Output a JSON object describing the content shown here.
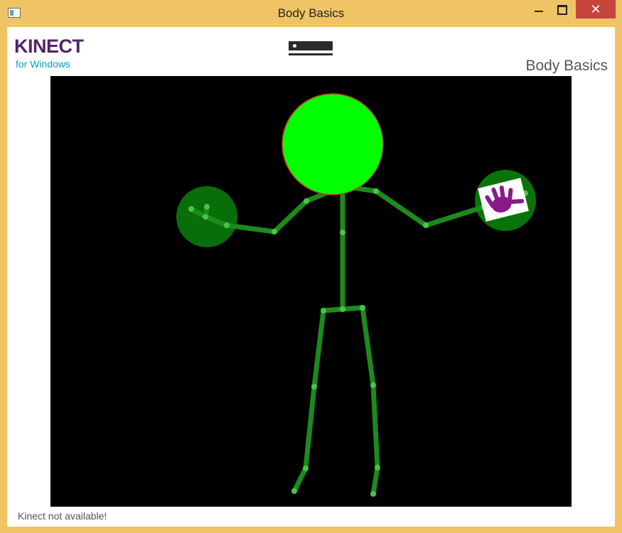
{
  "window": {
    "title": "Body Basics",
    "minimize_label": "",
    "maximize_label": "",
    "close_label": "✕"
  },
  "header": {
    "logo_main": "KINECT",
    "logo_sub": "for Windows",
    "app_title": "Body Basics"
  },
  "status": {
    "text": "Kinect not available!"
  },
  "colors": {
    "title_bar": "#f0c465",
    "bone": "#1c8a1c",
    "joint": "#44c844",
    "head": "#00ff00",
    "hand_open": "#0a7a0a",
    "hand_icon": "#8a1a8a"
  },
  "icons": [
    "app-icon",
    "kinect-sensor-icon",
    "hand-open-icon"
  ]
}
